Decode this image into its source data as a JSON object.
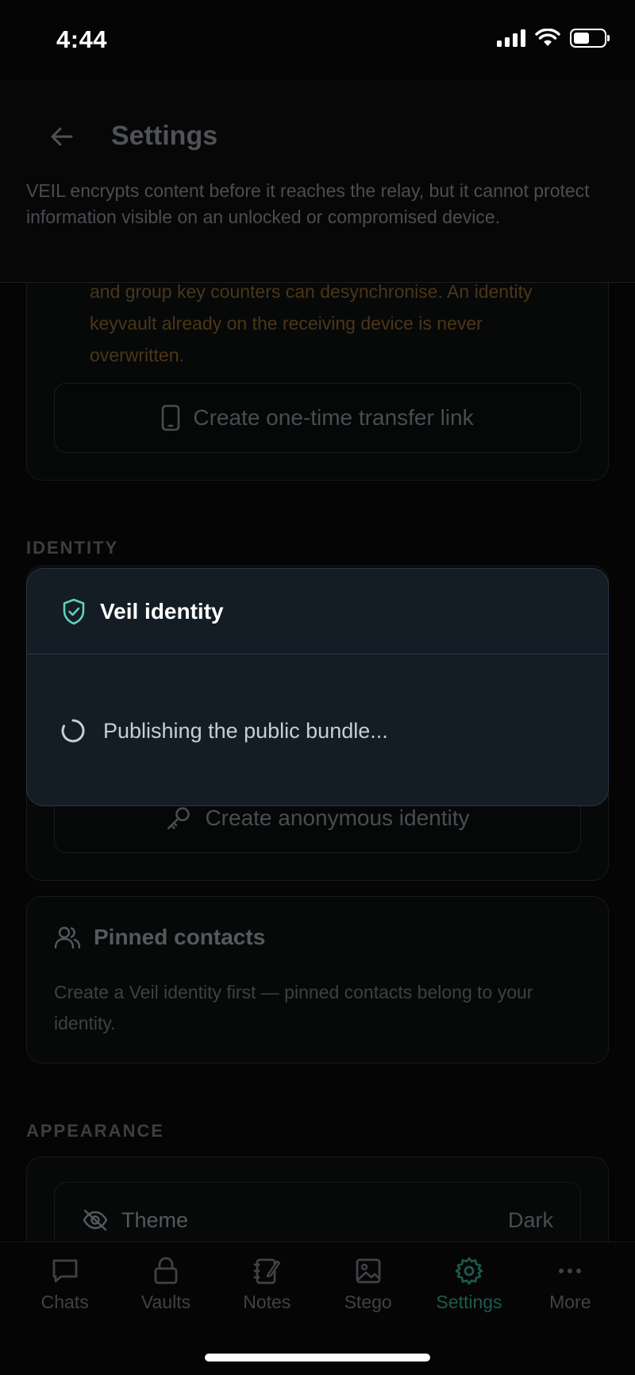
{
  "status_bar": {
    "time": "4:44"
  },
  "header": {
    "title": "Settings",
    "description": "VEIL encrypts content before it reaches the relay, but it cannot protect information visible on an unlocked or compromised device."
  },
  "transfer_card": {
    "warning": "and group key counters can desynchronise. An identity keyvault already on the receiving device is never overwritten.",
    "button_label": "Create one-time transfer link"
  },
  "identity_section": {
    "label": "IDENTITY",
    "anon_button_label": "Create anonymous identity"
  },
  "modal": {
    "title": "Veil identity",
    "status": "Publishing the public bundle..."
  },
  "pinned_contacts": {
    "title": "Pinned contacts",
    "body": "Create a Veil identity first — pinned contacts belong to your identity."
  },
  "appearance_section": {
    "label": "APPEARANCE",
    "theme_label": "Theme",
    "theme_value": "Dark"
  },
  "tabs": [
    {
      "label": "Chats",
      "icon": "chat-icon"
    },
    {
      "label": "Vaults",
      "icon": "lock-icon"
    },
    {
      "label": "Notes",
      "icon": "notebook-icon"
    },
    {
      "label": "Stego",
      "icon": "image-icon"
    },
    {
      "label": "Settings",
      "icon": "gear-icon",
      "active": true
    },
    {
      "label": "More",
      "icon": "more-icon"
    }
  ],
  "colors": {
    "accent": "#5ed3b8",
    "modal_bg": "#141c26",
    "warning_text": "#4b3619"
  }
}
